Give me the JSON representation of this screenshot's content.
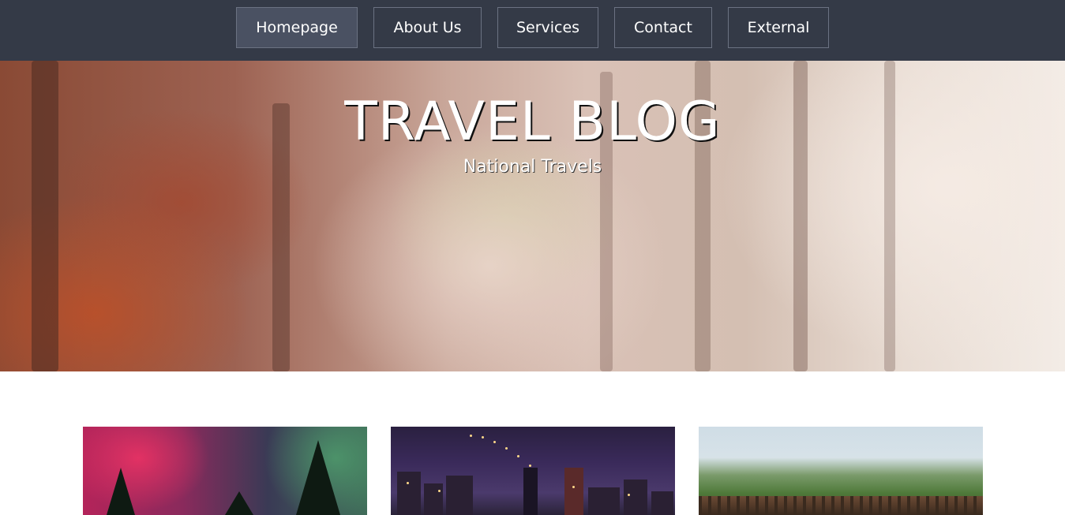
{
  "nav": {
    "items": [
      {
        "label": "Homepage",
        "active": true
      },
      {
        "label": "About Us",
        "active": false
      },
      {
        "label": "Services",
        "active": false
      },
      {
        "label": "Contact",
        "active": false
      },
      {
        "label": "External",
        "active": false
      }
    ]
  },
  "hero": {
    "title": "TRAVEL BLOG",
    "subtitle": "National Travels"
  },
  "colors": {
    "nav_background": "#343a47",
    "nav_active": "#4a5162",
    "nav_border": "#6b7282"
  },
  "cards": [
    {
      "image": "aurora-forest-photo"
    },
    {
      "image": "city-bridge-night-photo"
    },
    {
      "image": "railway-bridge-hills-photo"
    }
  ]
}
